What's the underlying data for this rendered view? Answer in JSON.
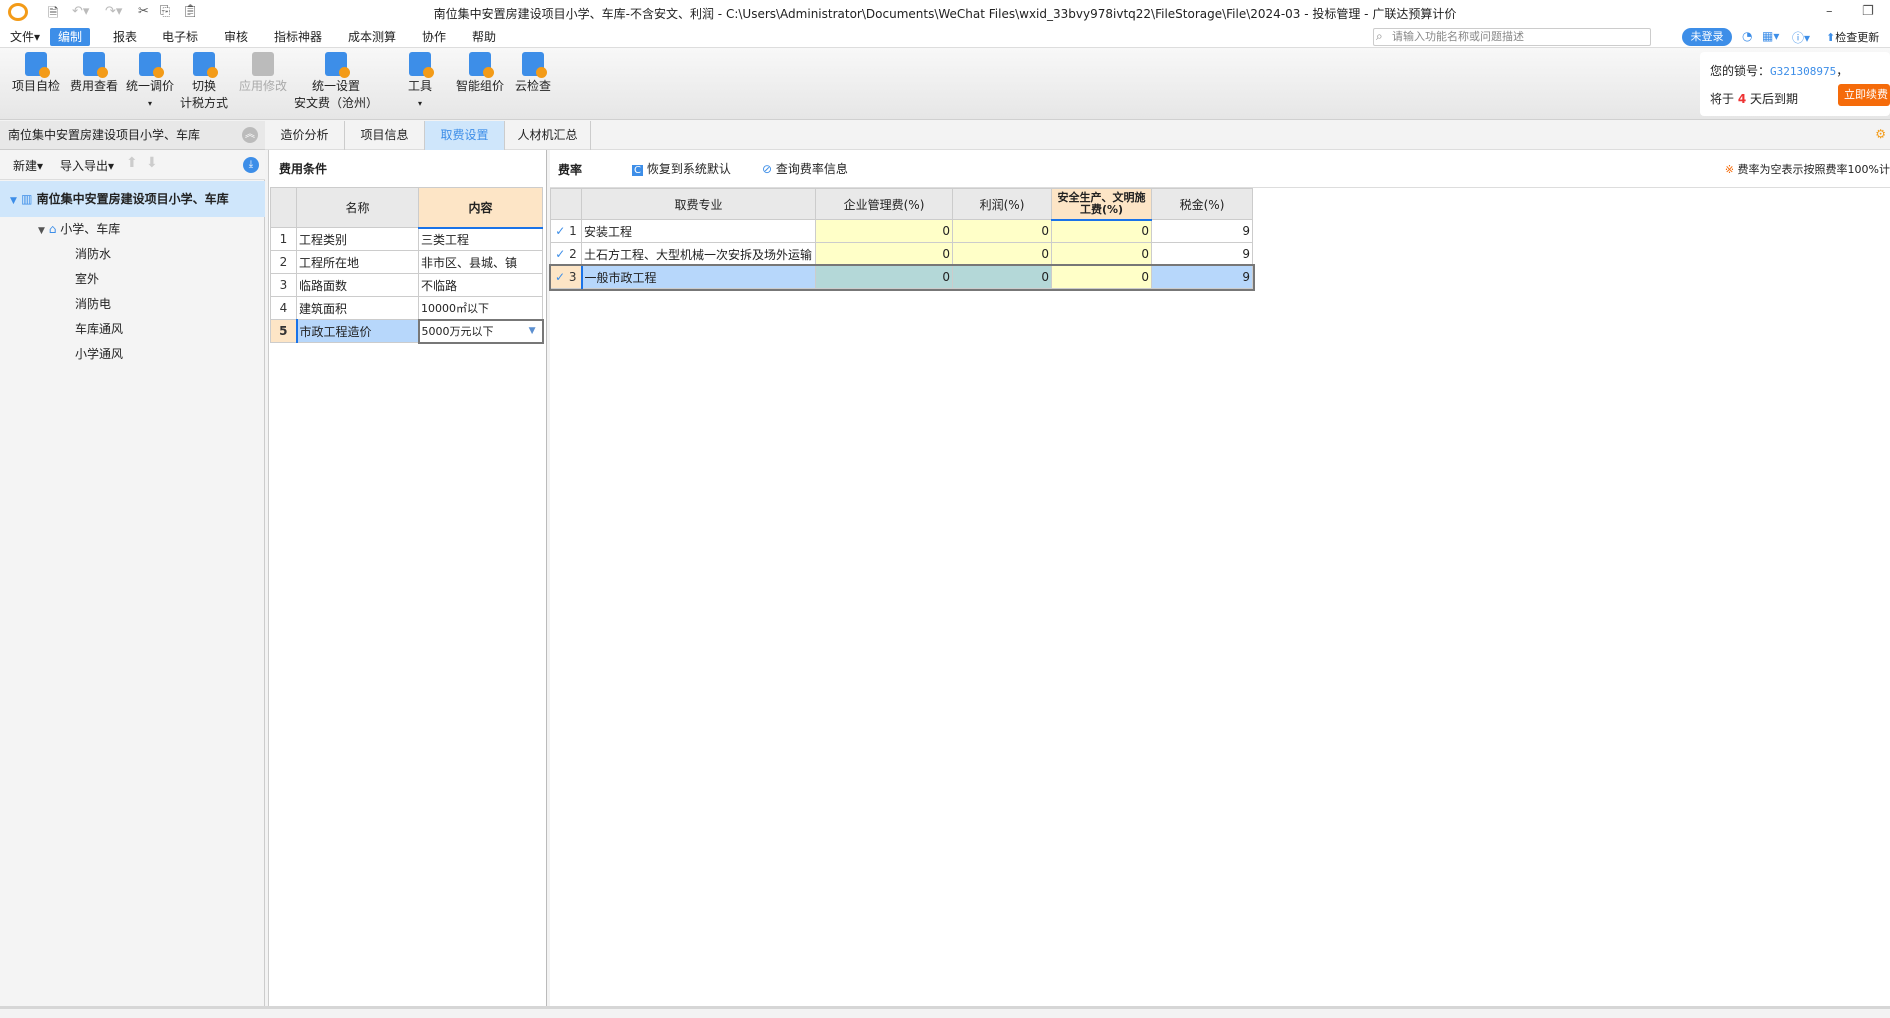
{
  "window": {
    "title": "南位集中安置房建设项目小学、车库-不含安文、利润 - C:\\Users\\Administrator\\Documents\\WeChat Files\\wxid_33bvy978ivtq22\\FileStorage\\File\\2024-03 - 投标管理 - 广联达预算计价"
  },
  "menu": [
    "文件▾",
    "编制",
    "报表",
    "电子标",
    "审核",
    "指标神器",
    "成本测算",
    "协作",
    "帮助"
  ],
  "search": {
    "placeholder": "请输入功能名称或问题描述"
  },
  "account": {
    "login": "未登录",
    "update": "检查更新"
  },
  "toolbar": [
    {
      "l1": "项目自检",
      "l2": ""
    },
    {
      "l1": "费用查看",
      "l2": ""
    },
    {
      "l1": "统一调价",
      "l2": "▾"
    },
    {
      "l1": "切换",
      "l2": "计税方式"
    },
    {
      "l1": "应用修改",
      "l2": ""
    },
    {
      "l1": "统一设置",
      "l2": "安文费（沧州）"
    },
    {
      "l1": "工具",
      "l2": "▾"
    },
    {
      "l1": "智能组价",
      "l2": ""
    },
    {
      "l1": "云检查",
      "l2": ""
    }
  ],
  "license": {
    "label": "您的锁号：",
    "code": "G321308975",
    "sep": "，",
    "expire_pre": "将于",
    "days": "4",
    "expire_post": "天后到期",
    "renew": "立即续费"
  },
  "left": {
    "header": "南位集中安置房建设项目小学、车库",
    "new": "新建▾",
    "io": "导入导出▾",
    "tree": {
      "root": "南位集中安置房建设项目小学、车库",
      "child": "小学、车库",
      "items": [
        "消防水",
        "室外",
        "消防电",
        "车库通风",
        "小学通风"
      ]
    }
  },
  "tabs": [
    "造价分析",
    "项目信息",
    "取费设置",
    "人材机汇总"
  ],
  "conditions": {
    "title": "费用条件",
    "headers": [
      "名称",
      "内容"
    ],
    "rows": [
      [
        "1",
        "工程类别",
        "三类工程"
      ],
      [
        "2",
        "工程所在地",
        "非市区、县城、镇"
      ],
      [
        "3",
        "临路面数",
        "不临路"
      ],
      [
        "4",
        "建筑面积",
        "10000㎡以下"
      ],
      [
        "5",
        "市政工程造价",
        "5000万元以下"
      ]
    ]
  },
  "rates": {
    "title": "费率",
    "restore": "恢复到系统默认",
    "query": "查询费率信息",
    "note": "费率为空表示按照费率100%计",
    "headers": [
      "取费专业",
      "企业管理费(%)",
      "利润(%)",
      "安全生产、文明施工费(%)",
      "税金(%)"
    ],
    "rows": [
      [
        "1",
        "安装工程",
        "0",
        "0",
        "0",
        "9"
      ],
      [
        "2",
        "土石方工程、大型机械一次安拆及场外运输",
        "0",
        "0",
        "0",
        "9"
      ],
      [
        "3",
        "一般市政工程",
        "0",
        "0",
        "0",
        "9"
      ]
    ]
  }
}
